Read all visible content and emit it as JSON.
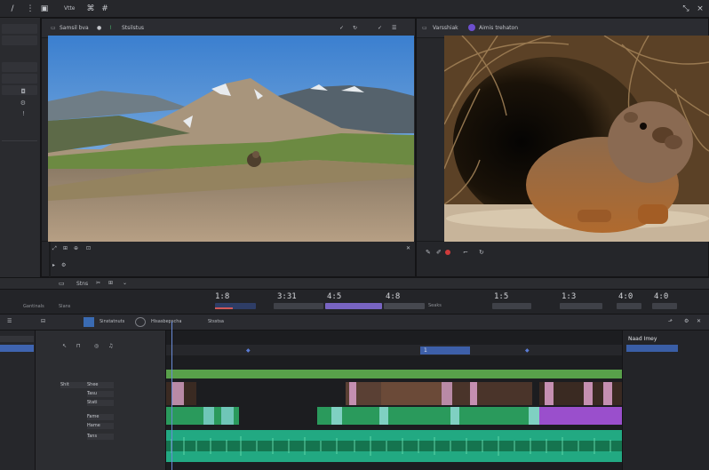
{
  "topbar": {
    "menu_item_1": "Vtte",
    "icons": [
      "slash-icon",
      "window-icon",
      "pin-icon",
      "grid-icon",
      "maximize-icon",
      "close-icon"
    ]
  },
  "left_viewer": {
    "title": "Samsil bva",
    "tab_label": "Stsilstus"
  },
  "right_viewer": {
    "label_1": "Varsshiak",
    "label_2": "Aimis trehaton"
  },
  "midbar": {
    "label": "Stns"
  },
  "metrics": {
    "items": [
      {
        "value": "1:8",
        "label": ""
      },
      {
        "value": "3:31",
        "label": ""
      },
      {
        "value": "4:5",
        "label": ""
      },
      {
        "value": "4:8",
        "label": "Seaks"
      },
      {
        "value": "1:5",
        "label": ""
      },
      {
        "value": "1:3",
        "label": ""
      },
      {
        "value": "4:0",
        "label": ""
      }
    ],
    "left_labels": [
      "Gantinals",
      "Slans"
    ]
  },
  "timeline_header": {
    "tabs": [
      "Sinstatnuts",
      "Hisasbepscha",
      "Stsstsa"
    ]
  },
  "timeline": {
    "tracks": [
      "Shit",
      "Shee",
      "Tasu",
      "Stati",
      "Fame",
      "Hame",
      "Tans"
    ],
    "right_title": "Naad Imey",
    "ruler_marker": "1"
  },
  "colors": {
    "accent": "#5a7bd4",
    "video_track": "#2a9a5c",
    "audio_track": "#22a982",
    "purple_clip": "#9a4fcc",
    "green_bar": "#58a04a"
  }
}
